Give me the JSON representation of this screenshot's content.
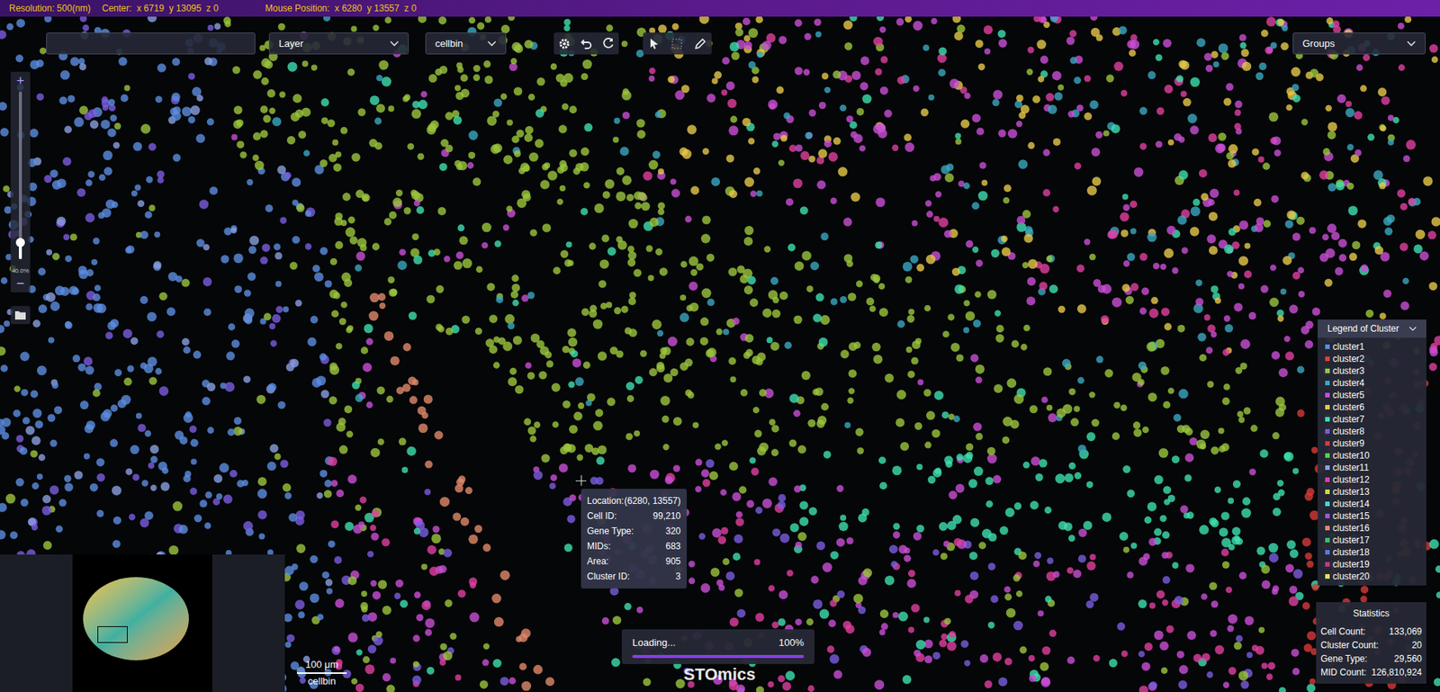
{
  "status_bar": {
    "resolution": "Resolution: 500(nm)",
    "center": "Center:  x 6719  y 13095  z 0",
    "mouse": "Mouse Position:  x 6280  y 13557  z 0"
  },
  "toolbar": {
    "layer": "Layer",
    "bin": "cellbin",
    "groups": "Groups",
    "tools": [
      {
        "disabled": false
      },
      {
        "disabled": true
      },
      {
        "disabled": false
      }
    ]
  },
  "zoom": {
    "plus": "+",
    "minus": "−",
    "level": 0.1,
    "reading": "40.0%"
  },
  "tooltip": {
    "rows": [
      {
        "label": "Location:",
        "value": "(6280, 13557)"
      },
      {
        "label": "Cell ID:",
        "value": "99,210"
      },
      {
        "label": "Gene Type:",
        "value": "320"
      },
      {
        "label": "MIDs:",
        "value": "683"
      },
      {
        "label": "Area:",
        "value": "905"
      },
      {
        "label": "Cluster ID:",
        "value": "3"
      }
    ]
  },
  "loading": {
    "label": "Loading...",
    "reading": "100%",
    "level": 1
  },
  "watermark": "STOmics",
  "scale_bar": {
    "length": "100 μm",
    "layer": "cellbin"
  },
  "legend": {
    "title": "Legend of Cluster",
    "items": [
      {
        "label": "cluster1",
        "color": "#5b8de0"
      },
      {
        "label": "cluster2",
        "color": "#e0403a"
      },
      {
        "label": "cluster3",
        "color": "#9bc53d"
      },
      {
        "label": "cluster4",
        "color": "#3aa8c1"
      },
      {
        "label": "cluster5",
        "color": "#c94fd6"
      },
      {
        "label": "cluster6",
        "color": "#e6c84a"
      },
      {
        "label": "cluster7",
        "color": "#3de0b0"
      },
      {
        "label": "cluster8",
        "color": "#7b5ce0"
      },
      {
        "label": "cluster9",
        "color": "#d63a3a"
      },
      {
        "label": "cluster10",
        "color": "#4cd64c"
      },
      {
        "label": "cluster11",
        "color": "#8aa0e0"
      },
      {
        "label": "cluster12",
        "color": "#e040a0"
      },
      {
        "label": "cluster13",
        "color": "#c0e040"
      },
      {
        "label": "cluster14",
        "color": "#4ad6d6"
      },
      {
        "label": "cluster15",
        "color": "#9b59d6"
      },
      {
        "label": "cluster16",
        "color": "#e08a6a"
      },
      {
        "label": "cluster17",
        "color": "#3ac070"
      },
      {
        "label": "cluster18",
        "color": "#5a7ae0"
      },
      {
        "label": "cluster19",
        "color": "#c03a8a"
      },
      {
        "label": "cluster20",
        "color": "#e0e060"
      }
    ]
  },
  "statistics": {
    "title": "Statistics",
    "rows": [
      {
        "label": "Cell Count:",
        "value": "133,069"
      },
      {
        "label": "Cluster Count:",
        "value": "20"
      },
      {
        "label": "Gene Type:",
        "value": "29,560"
      },
      {
        "label": "MID Count:",
        "value": "126,810,924"
      }
    ]
  }
}
